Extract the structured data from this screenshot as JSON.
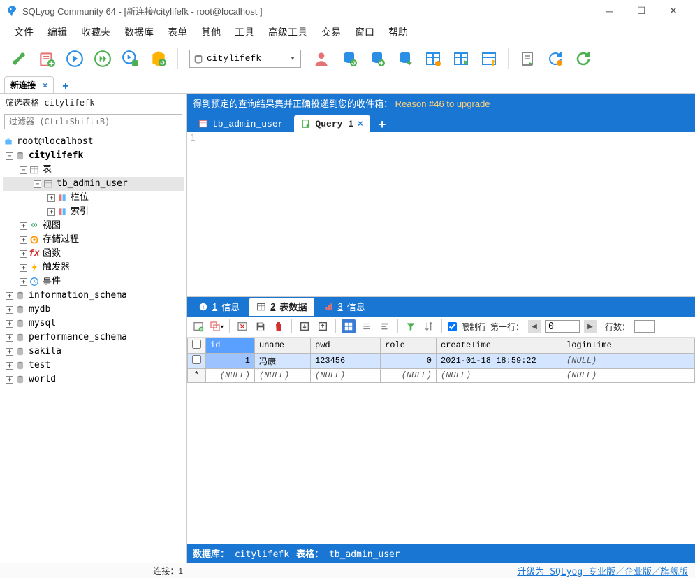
{
  "title": "SQLyog Community 64 - [新连接/citylifefk - root@localhost ]",
  "menu": [
    "文件",
    "编辑",
    "收藏夹",
    "数据库",
    "表单",
    "其他",
    "工具",
    "高级工具",
    "交易",
    "窗口",
    "帮助"
  ],
  "conn_tab": "新连接",
  "db_selected": "citylifefk",
  "sidebar": {
    "filter_label": "筛选表格 citylifefk",
    "filter_placeholder": "过滤器 (Ctrl+Shift+B)",
    "root": "root@localhost",
    "db": "citylifefk",
    "tables_label": "表",
    "table": "tb_admin_user",
    "columns_label": "栏位",
    "indexes_label": "索引",
    "views": "视图",
    "procs": "存储过程",
    "funcs": "函数",
    "triggers": "触发器",
    "events": "事件",
    "other_dbs": [
      "information_schema",
      "mydb",
      "mysql",
      "performance_schema",
      "sakila",
      "test",
      "world"
    ]
  },
  "banner": {
    "text": "得到预定的查询结果集并正确投递到您的收件箱：",
    "reason": "Reason #46 to upgrade"
  },
  "editor_tabs": {
    "tab1": "tb_admin_user",
    "tab2": "Query 1"
  },
  "editor_line": "1",
  "result_tabs": {
    "t1": "信息",
    "t2": "表数据",
    "t3": "信息"
  },
  "data_toolbar": {
    "limit_label": "限制行",
    "firstrow_label": "第一行：",
    "firstrow_value": "0",
    "rowcount_label": "行数："
  },
  "grid": {
    "cols": [
      "id",
      "uname",
      "pwd",
      "role",
      "createTime",
      "loginTime"
    ],
    "rows": [
      {
        "sel": true,
        "id": "1",
        "uname": "冯康",
        "pwd": "123456",
        "role": "0",
        "createTime": "2021-01-18 18:59:22",
        "loginTime": "(NULL)"
      },
      {
        "sel": false,
        "id": "(NULL)",
        "uname": "(NULL)",
        "pwd": "(NULL)",
        "role": "(NULL)",
        "createTime": "(NULL)",
        "loginTime": "(NULL)"
      }
    ]
  },
  "dbfooter": {
    "dblabel": "数据库：",
    "dbval": "citylifefk",
    "tbllabel": "表格：",
    "tblval": "tb_admin_user"
  },
  "status": {
    "conn": "连接：1",
    "upgrade": "升级为 SQLyog 专业版／企业版／旗舰版"
  }
}
